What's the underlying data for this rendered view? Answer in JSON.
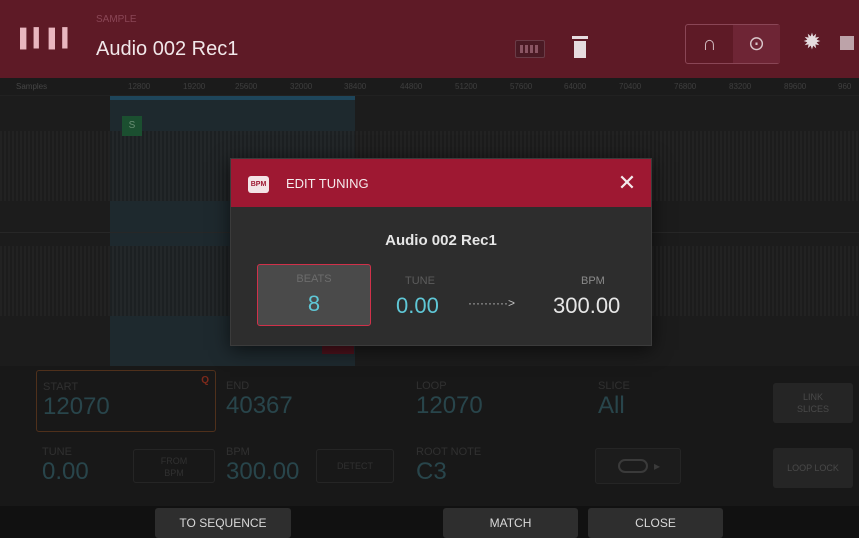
{
  "header": {
    "subtitle": "SAMPLE",
    "title": "Audio 002 Rec1"
  },
  "ruler": {
    "label": "Samples",
    "ticks": [
      "12800",
      "19200",
      "25600",
      "32000",
      "38400",
      "44800",
      "51200",
      "57600",
      "64000",
      "70400",
      "76800",
      "83200",
      "89600",
      "960"
    ]
  },
  "params": {
    "start": {
      "label": "START",
      "value": "12070",
      "quantize": "Q"
    },
    "end": {
      "label": "END",
      "value": "40367"
    },
    "loop": {
      "label": "LOOP",
      "value": "12070"
    },
    "slice": {
      "label": "SLICE",
      "value": "All"
    },
    "tune": {
      "label": "TUNE",
      "value": "0.00"
    },
    "from_bpm": "FROM\nBPM",
    "bpm": {
      "label": "BPM",
      "value": "300.00"
    },
    "detect": "DETECT",
    "root_note": {
      "label": "ROOT NOTE",
      "value": "C3"
    },
    "link_slices": "LINK\nSLICES",
    "loop_lock": "LOOP LOCK"
  },
  "dialog": {
    "icon_text": "BPM",
    "title": "EDIT TUNING",
    "sample_name": "Audio 002 Rec1",
    "beats": {
      "label": "BEATS",
      "value": "8"
    },
    "tune": {
      "label": "TUNE",
      "value": "0.00"
    },
    "arrow": "··········>",
    "bpm": {
      "label": "BPM",
      "value": "300.00"
    }
  },
  "footer": {
    "to_sequence": "TO SEQUENCE",
    "match": "MATCH",
    "close": "CLOSE"
  },
  "colors": {
    "header_bg": "#5e1a26",
    "dialog_header": "#9e1832",
    "accent_cyan": "#5fc7d6",
    "beats_border": "#d0314a"
  }
}
